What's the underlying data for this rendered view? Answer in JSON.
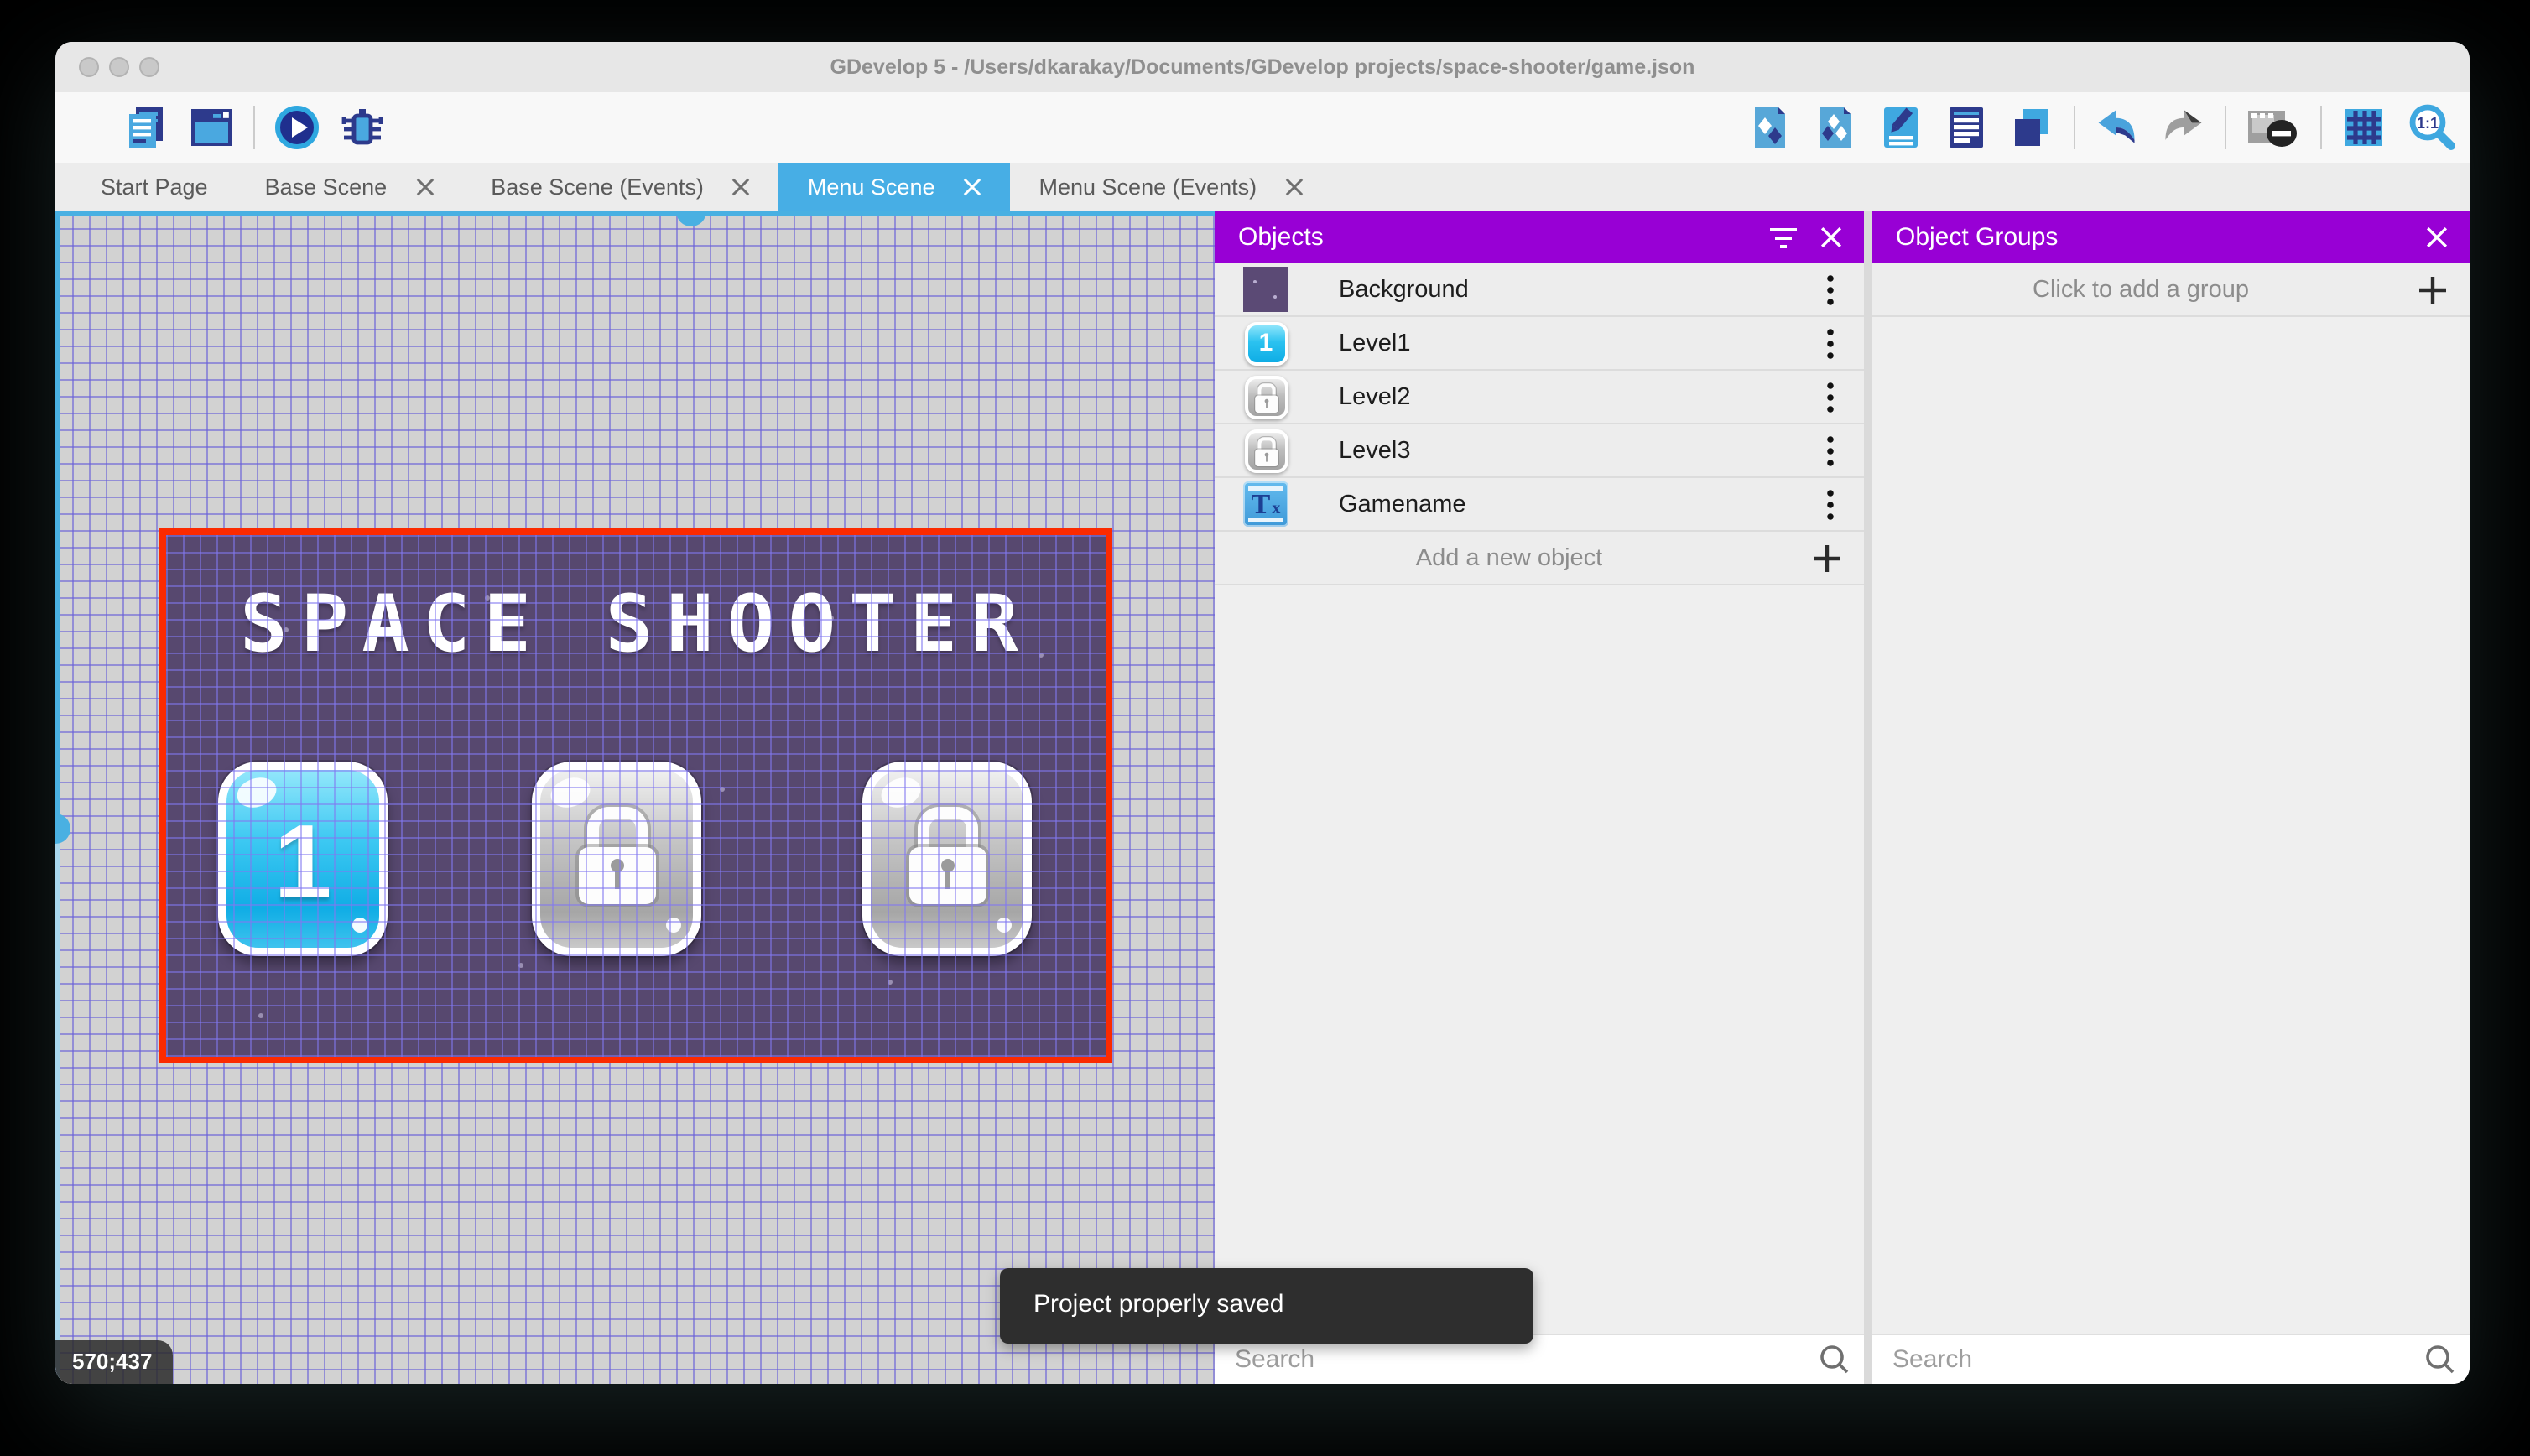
{
  "window": {
    "title": "GDevelop 5 - /Users/dkarakay/Documents/GDevelop projects/space-shooter/game.json"
  },
  "toolbar": {
    "left_icons": [
      "project-manager",
      "start-page-window",
      "preview-play",
      "debug"
    ],
    "right_icons": [
      "objects",
      "object-groups",
      "properties",
      "instances-list",
      "layers",
      "undo",
      "redo",
      "toggle-window-mask",
      "grid",
      "zoom-reset"
    ],
    "zoom_reset_label": "1:1"
  },
  "tabs": [
    {
      "label": "Start Page",
      "active": false,
      "closable": false
    },
    {
      "label": "Base Scene",
      "active": false,
      "closable": true
    },
    {
      "label": "Base Scene (Events)",
      "active": false,
      "closable": true
    },
    {
      "label": "Menu Scene",
      "active": true,
      "closable": true
    },
    {
      "label": "Menu Scene (Events)",
      "active": false,
      "closable": true
    }
  ],
  "canvas": {
    "coordinates": "570;437",
    "scene": {
      "title": "SPACE SHOOTER",
      "buttons": [
        {
          "label": "1",
          "state": "unlocked"
        },
        {
          "label": "",
          "state": "locked"
        },
        {
          "label": "",
          "state": "locked"
        }
      ]
    }
  },
  "objects_panel": {
    "title": "Objects",
    "items": [
      {
        "name": "Background",
        "thumb": "purple-square"
      },
      {
        "name": "Level1",
        "thumb": "blue-button-1",
        "thumb_label": "1"
      },
      {
        "name": "Level2",
        "thumb": "gray-lock-button"
      },
      {
        "name": "Level3",
        "thumb": "gray-lock-button"
      },
      {
        "name": "Gamename",
        "thumb": "text-object",
        "thumb_label": "T",
        "thumb_sub": "x"
      }
    ],
    "add_label": "Add a new object",
    "search_placeholder": "Search"
  },
  "groups_panel": {
    "title": "Object Groups",
    "empty_label": "Click to add a group",
    "search_placeholder": "Search"
  },
  "toast": {
    "message": "Project properly saved"
  },
  "colors": {
    "accent_blue": "#47aee5",
    "panel_header_purple": "#9800d5",
    "selection_red": "#fb2a00",
    "toast_bg": "#2e2e2e",
    "scene_bg": "#57486f"
  }
}
